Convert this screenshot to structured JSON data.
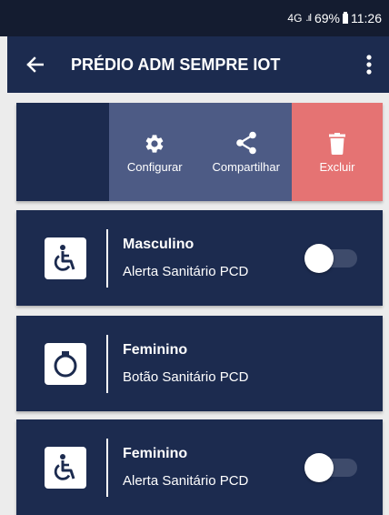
{
  "status_bar": {
    "network": "4G",
    "signal": ".ıl",
    "battery": "69%",
    "time": "11:26"
  },
  "app_bar": {
    "title": "PRÉDIO ADM SEMPRE IOT",
    "back_icon": "arrow-left-icon",
    "menu_icon": "more-vertical-icon"
  },
  "swipe_actions": {
    "configure_label": "Configurar",
    "share_label": "Compartilhar",
    "delete_label": "Excluir",
    "colors": {
      "card": "#1c2b4f",
      "actions": "#4d5b85",
      "delete": "#e57373"
    }
  },
  "devices": [
    {
      "name": "Masculino",
      "type": "Alerta Sanitário PCD",
      "icon": "wheelchair-icon",
      "toggle": false
    },
    {
      "name": "Feminino",
      "type": "Botão Sanitário PCD",
      "icon": "push-button-icon"
    },
    {
      "name": "Feminino",
      "type": "Alerta Sanitário PCD",
      "icon": "wheelchair-icon",
      "toggle": false
    }
  ]
}
